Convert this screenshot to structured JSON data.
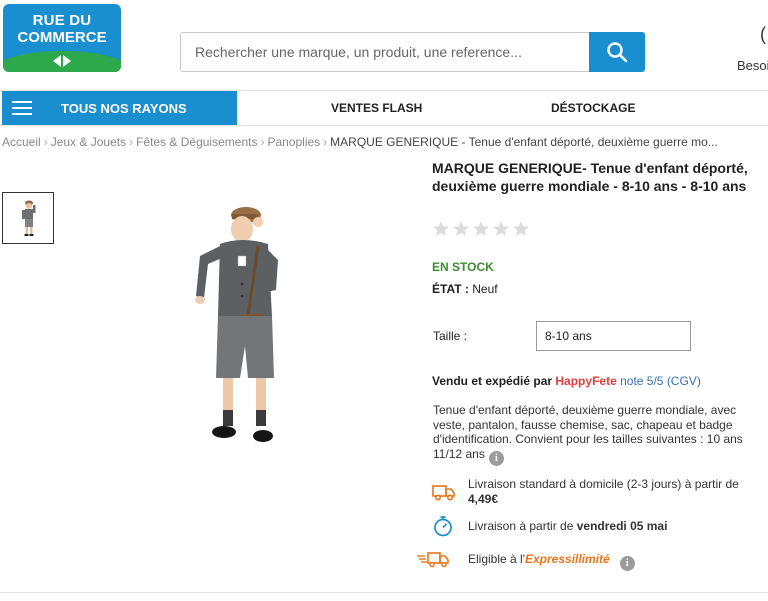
{
  "header": {
    "logo_line1": "RUE DU",
    "logo_line2": "COMMERCE",
    "search_placeholder": "Rechercher une marque, un produit, une reference...",
    "help_text": "Besoi"
  },
  "nav": {
    "rayons_label": "TOUS NOS RAYONS",
    "links": [
      "VENTES FLASH",
      "DÉSTOCKAGE"
    ]
  },
  "breadcrumb": {
    "items": [
      "Accueil",
      "Jeux & Jouets",
      "Fêtes & Déguisements",
      "Panoplies"
    ],
    "current": "MARQUE GENERIQUE - Tenue d'enfant déporté, deuxième guerre mo..."
  },
  "product": {
    "title": "MARQUE GENERIQUE- Tenue d'enfant déporté, deuxième guerre mondiale - 8-10 ans - 8-10 ans",
    "rating_stars": 0,
    "stock": "EN STOCK",
    "etat_label": "ÉTAT :",
    "etat_value": "Neuf",
    "size_label": "Taille :",
    "size_value": "8-10 ans",
    "sold_by_label": "Vendu et expédié par",
    "seller": "HappyFete",
    "seller_note": "note 5/5",
    "seller_cgv": "(CGV)",
    "description": "Tenue d'enfant déporté, deuxième guerre mondiale, avec veste, pantalon, fausse chemise, sac, chapeau et badge d'identification. Convient pour les tailles suivantes : 10 ans 11/12 ans",
    "delivery": [
      {
        "text": "Livraison standard à domicile (2-3 jours) à partir de",
        "bold": "4,49€"
      },
      {
        "text": "Livraison à partir de",
        "bold": "vendredi 05 mai"
      }
    ],
    "express_prefix": "Eligible à l'",
    "express_brand_a": "Express",
    "express_brand_b": "illimité"
  },
  "colors": {
    "brand_blue": "#1a8fcf",
    "stock_green": "#3c8d2f",
    "seller_red": "#e0403a",
    "express_orange": "#e8751a"
  }
}
